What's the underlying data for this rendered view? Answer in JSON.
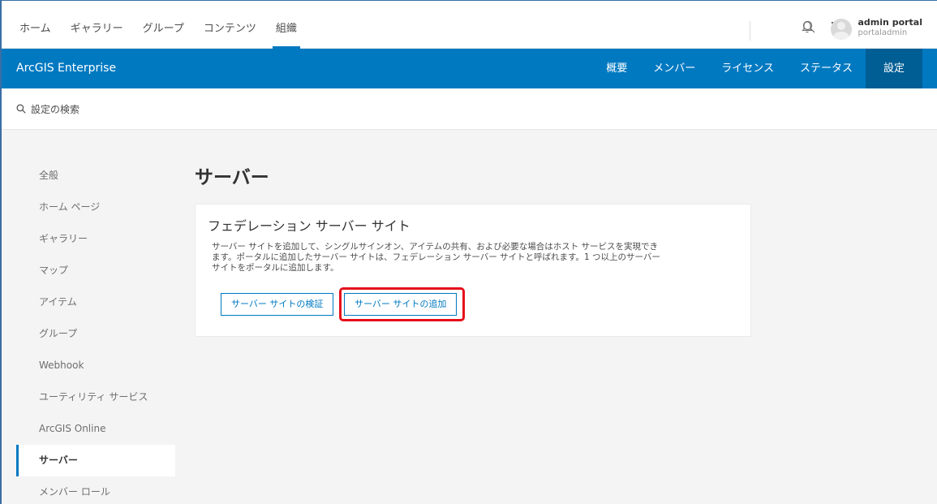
{
  "top_nav": {
    "links": [
      "ホーム",
      "ギャラリー",
      "グループ",
      "コンテンツ",
      "組織"
    ],
    "active_index": 4,
    "icons": [
      "search-icon",
      "bell-icon",
      "apps-grid-icon"
    ],
    "user": {
      "name": "admin portal",
      "username": "portaladmin"
    }
  },
  "org_header": {
    "brand": "ArcGIS Enterprise",
    "tabs": [
      "概要",
      "メンバー",
      "ライセンス",
      "ステータス",
      "設定"
    ],
    "active_tab": "設定",
    "accent_color": "#0079c1"
  },
  "settings_search": {
    "label": "設定の検索"
  },
  "sidebar": {
    "items": [
      "全般",
      "ホーム ページ",
      "ギャラリー",
      "マップ",
      "アイテム",
      "グループ",
      "Webhook",
      "ユーティリティ サービス",
      "ArcGIS Online",
      "サーバー",
      "メンバー ロール"
    ],
    "active": "サーバー"
  },
  "main": {
    "title": "サーバー",
    "card": {
      "heading": "フェデレーション サーバー サイト",
      "description_lines": [
        "サーバー サイトを追加して、シングルサインオン、アイテムの共有、および必要な場合はホスト サービスを実現でき",
        "ます。ポータルに追加したサーバー サイトは、フェデレーション サーバー サイトと呼ばれます。1 つ以上のサーバー",
        "サイトをポータルに追加します。"
      ],
      "verify_button": "サーバー サイトの検証",
      "add_button": "サーバー サイトの追加"
    },
    "highlight_color": "#e5101a"
  }
}
